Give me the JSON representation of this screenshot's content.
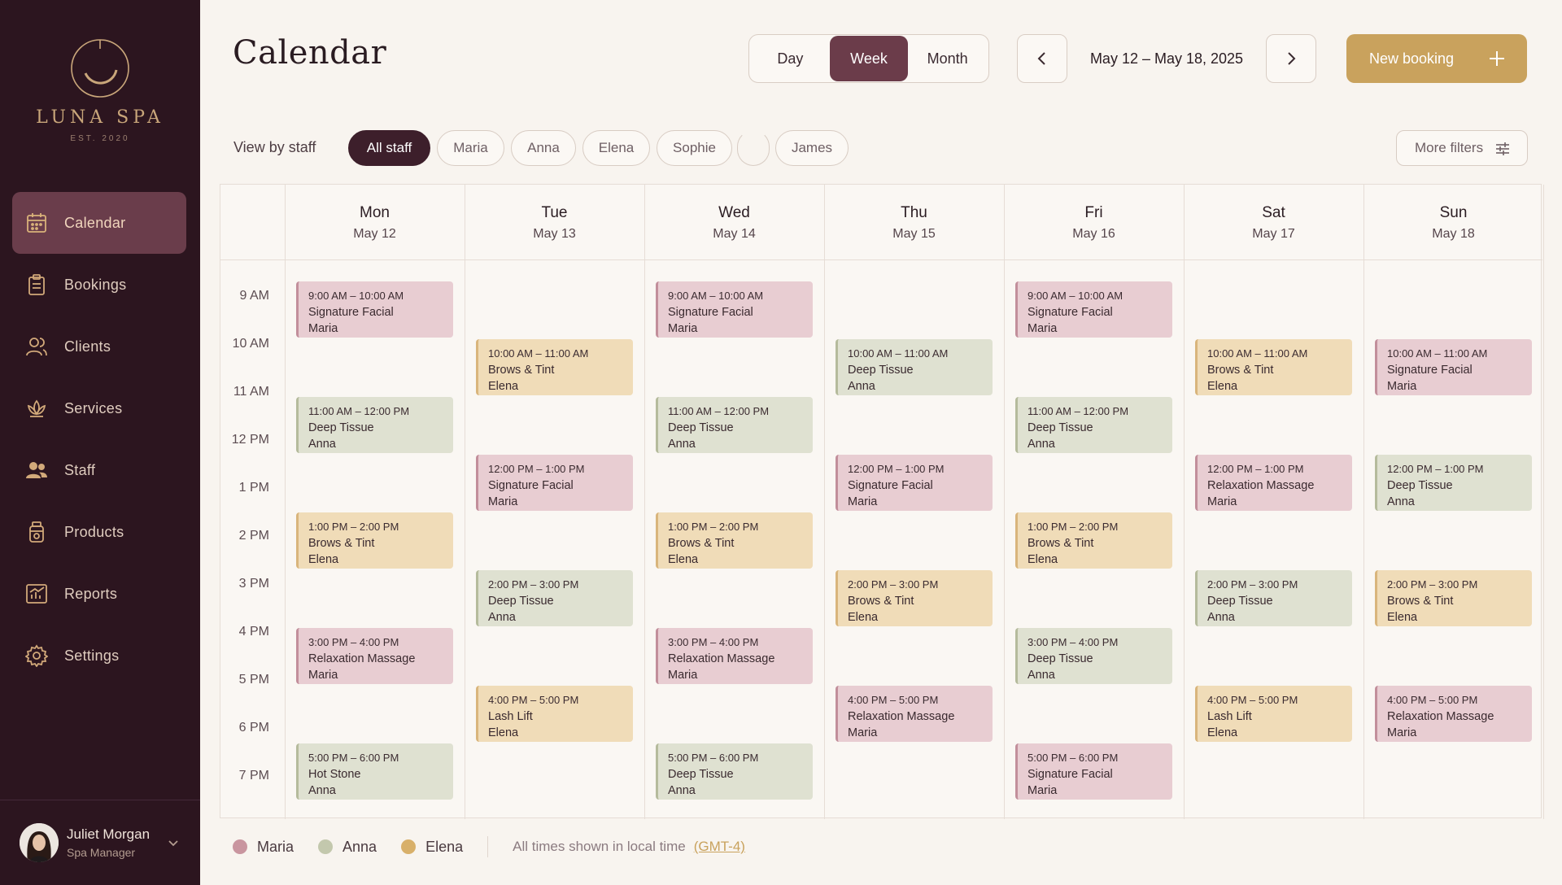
{
  "brand": {
    "name": "LUNA SPA",
    "established": "EST. 2020"
  },
  "nav": [
    {
      "label": "Calendar",
      "icon": "calendar-icon",
      "active": true
    },
    {
      "label": "Bookings",
      "icon": "clipboard-icon",
      "active": false
    },
    {
      "label": "Clients",
      "icon": "users-icon",
      "active": false
    },
    {
      "label": "Services",
      "icon": "lotus-icon",
      "active": false
    },
    {
      "label": "Staff",
      "icon": "team-icon",
      "active": false
    },
    {
      "label": "Products",
      "icon": "bottle-icon",
      "active": false
    },
    {
      "label": "Reports",
      "icon": "chart-icon",
      "active": false
    },
    {
      "label": "Settings",
      "icon": "gear-icon",
      "active": false
    }
  ],
  "user": {
    "name": "Juliet Morgan",
    "role": "Spa Manager"
  },
  "header": {
    "title": "Calendar",
    "views": [
      "Day",
      "Week",
      "Month"
    ],
    "active_view": "Week",
    "date_range": "May 12 – May 18, 2025",
    "new_booking": "New booking"
  },
  "filters": {
    "label": "View by staff",
    "chips": [
      "All staff",
      "Maria",
      "Anna",
      "Elena",
      "Sophie",
      "James"
    ],
    "active_chip": "All staff",
    "more": "More filters"
  },
  "days": [
    {
      "name": "Mon",
      "date": "May 12"
    },
    {
      "name": "Tue",
      "date": "May 13"
    },
    {
      "name": "Wed",
      "date": "May 14"
    },
    {
      "name": "Thu",
      "date": "May 15"
    },
    {
      "name": "Fri",
      "date": "May 16"
    },
    {
      "name": "Sat",
      "date": "May 17"
    },
    {
      "name": "Sun",
      "date": "May 18"
    }
  ],
  "times": [
    "9 AM",
    "10 AM",
    "11 AM",
    "12 PM",
    "1 PM",
    "2 PM",
    "3 PM",
    "4 PM",
    "5 PM",
    "6 PM",
    "7 PM"
  ],
  "events": [
    {
      "day": 0,
      "start": 9,
      "end": 10,
      "time": "9:00 AM – 10:00 AM",
      "service": "Signature Facial",
      "staff": "Maria"
    },
    {
      "day": 0,
      "start": 11,
      "end": 12,
      "time": "11:00 AM – 12:00 PM",
      "service": "Deep Tissue",
      "staff": "Anna"
    },
    {
      "day": 0,
      "start": 13,
      "end": 14,
      "time": "1:00 PM – 2:00 PM",
      "service": "Brows & Tint",
      "staff": "Elena"
    },
    {
      "day": 0,
      "start": 15,
      "end": 16,
      "time": "3:00 PM – 4:00 PM",
      "service": "Relaxation Massage",
      "staff": "Maria"
    },
    {
      "day": 0,
      "start": 17,
      "end": 18,
      "time": "5:00 PM – 6:00 PM",
      "service": "Hot Stone",
      "staff": "Anna"
    },
    {
      "day": 1,
      "start": 10,
      "end": 11,
      "time": "10:00 AM – 11:00 AM",
      "service": "Brows & Tint",
      "staff": "Elena"
    },
    {
      "day": 1,
      "start": 12,
      "end": 13,
      "time": "12:00 PM – 1:00 PM",
      "service": "Signature Facial",
      "staff": "Maria"
    },
    {
      "day": 1,
      "start": 14,
      "end": 15,
      "time": "2:00 PM – 3:00 PM",
      "service": "Deep Tissue",
      "staff": "Anna"
    },
    {
      "day": 1,
      "start": 16,
      "end": 17,
      "time": "4:00 PM – 5:00 PM",
      "service": "Lash Lift",
      "staff": "Elena"
    },
    {
      "day": 2,
      "start": 9,
      "end": 10,
      "time": "9:00 AM – 10:00 AM",
      "service": "Signature Facial",
      "staff": "Maria"
    },
    {
      "day": 2,
      "start": 11,
      "end": 12,
      "time": "11:00 AM – 12:00 PM",
      "service": "Deep Tissue",
      "staff": "Anna"
    },
    {
      "day": 2,
      "start": 13,
      "end": 14,
      "time": "1:00 PM – 2:00 PM",
      "service": "Brows & Tint",
      "staff": "Elena"
    },
    {
      "day": 2,
      "start": 15,
      "end": 16,
      "time": "3:00 PM – 4:00 PM",
      "service": "Relaxation Massage",
      "staff": "Maria"
    },
    {
      "day": 2,
      "start": 17,
      "end": 18,
      "time": "5:00 PM – 6:00 PM",
      "service": "Deep Tissue",
      "staff": "Anna"
    },
    {
      "day": 3,
      "start": 10,
      "end": 11,
      "time": "10:00 AM – 11:00 AM",
      "service": "Deep Tissue",
      "staff": "Anna"
    },
    {
      "day": 3,
      "start": 12,
      "end": 13,
      "time": "12:00 PM – 1:00 PM",
      "service": "Signature Facial",
      "staff": "Maria"
    },
    {
      "day": 3,
      "start": 14,
      "end": 15,
      "time": "2:00 PM – 3:00 PM",
      "service": "Brows & Tint",
      "staff": "Elena"
    },
    {
      "day": 3,
      "start": 16,
      "end": 17,
      "time": "4:00 PM – 5:00 PM",
      "service": "Relaxation Massage",
      "staff": "Maria"
    },
    {
      "day": 4,
      "start": 9,
      "end": 10,
      "time": "9:00 AM – 10:00 AM",
      "service": "Signature Facial",
      "staff": "Maria"
    },
    {
      "day": 4,
      "start": 11,
      "end": 12,
      "time": "11:00 AM – 12:00 PM",
      "service": "Deep Tissue",
      "staff": "Anna"
    },
    {
      "day": 4,
      "start": 13,
      "end": 14,
      "time": "1:00 PM – 2:00 PM",
      "service": "Brows & Tint",
      "staff": "Elena"
    },
    {
      "day": 4,
      "start": 15,
      "end": 16,
      "time": "3:00 PM – 4:00 PM",
      "service": "Deep Tissue",
      "staff": "Anna"
    },
    {
      "day": 4,
      "start": 17,
      "end": 18,
      "time": "5:00 PM – 6:00 PM",
      "service": "Signature Facial",
      "staff": "Maria"
    },
    {
      "day": 5,
      "start": 10,
      "end": 11,
      "time": "10:00 AM – 11:00 AM",
      "service": "Brows & Tint",
      "staff": "Elena"
    },
    {
      "day": 5,
      "start": 12,
      "end": 13,
      "time": "12:00 PM – 1:00 PM",
      "service": "Relaxation Massage",
      "staff": "Maria"
    },
    {
      "day": 5,
      "start": 14,
      "end": 15,
      "time": "2:00 PM – 3:00 PM",
      "service": "Deep Tissue",
      "staff": "Anna"
    },
    {
      "day": 5,
      "start": 16,
      "end": 17,
      "time": "4:00 PM – 5:00 PM",
      "service": "Lash Lift",
      "staff": "Elena"
    },
    {
      "day": 6,
      "start": 10,
      "end": 11,
      "time": "10:00 AM – 11:00 AM",
      "service": "Signature Facial",
      "staff": "Maria"
    },
    {
      "day": 6,
      "start": 12,
      "end": 13,
      "time": "12:00 PM – 1:00 PM",
      "service": "Deep Tissue",
      "staff": "Anna"
    },
    {
      "day": 6,
      "start": 14,
      "end": 15,
      "time": "2:00 PM – 3:00 PM",
      "service": "Brows & Tint",
      "staff": "Elena"
    },
    {
      "day": 6,
      "start": 16,
      "end": 17,
      "time": "4:00 PM – 5:00 PM",
      "service": "Relaxation Massage",
      "staff": "Maria"
    }
  ],
  "legend": [
    {
      "name": "Maria",
      "color": "#c9959f"
    },
    {
      "name": "Anna",
      "color": "#c3c8ad"
    },
    {
      "name": "Elena",
      "color": "#d8b06a"
    }
  ],
  "timezone": {
    "note": "All times shown in local time",
    "zone": "(GMT-4)"
  },
  "colors": {
    "sidebar": "#2c151f",
    "accent": "#6b3c4a",
    "gold": "#c9a25d",
    "background": "#f8f4ef"
  }
}
